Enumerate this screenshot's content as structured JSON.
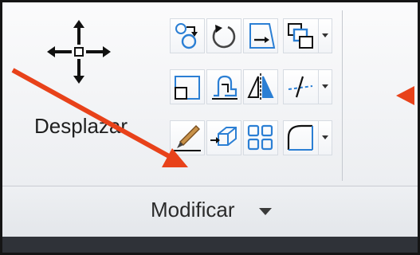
{
  "panel": {
    "move_label": "Desplazar",
    "footer_label": "Modificar"
  },
  "icons": {
    "move": "move-icon",
    "copy": "copy-icon",
    "rotate": "rotate-icon",
    "mirror": "mirror-icon",
    "scale": "scale-icon",
    "stretch": "stretch-icon",
    "align": "align-icon",
    "edit": "edit-icon",
    "shift": "shift-icon",
    "array": "array-icon",
    "draworder": "draw-order-icon",
    "trim": "trim-icon",
    "fillet": "fillet-icon"
  },
  "colors": {
    "icon_blue": "#2b7fd4",
    "arrow_red": "#e8421a"
  }
}
